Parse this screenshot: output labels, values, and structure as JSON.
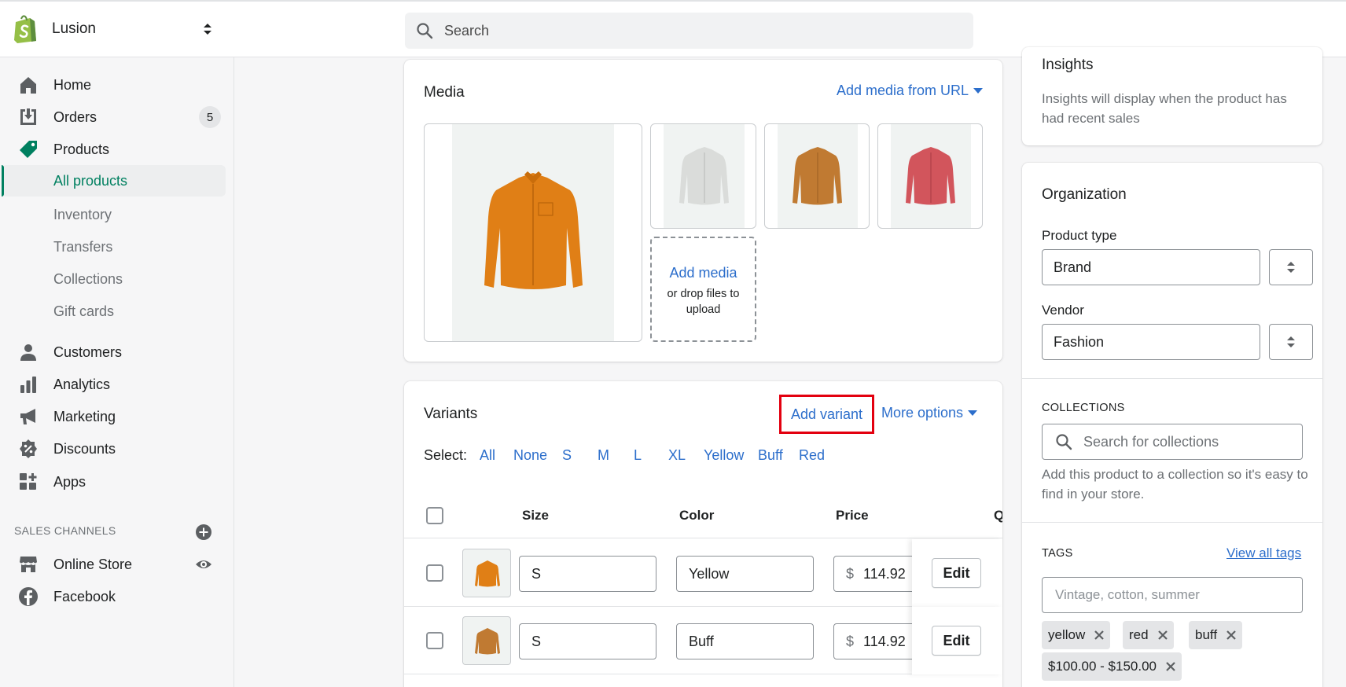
{
  "store": {
    "name": "Lusion"
  },
  "search": {
    "placeholder": "Search"
  },
  "sidebar": {
    "items": [
      {
        "label": "Home",
        "icon": "home-icon"
      },
      {
        "label": "Orders",
        "icon": "orders-icon",
        "badge": "5"
      },
      {
        "label": "Products",
        "icon": "tag-icon"
      },
      {
        "label": "All products"
      },
      {
        "label": "Inventory"
      },
      {
        "label": "Transfers"
      },
      {
        "label": "Collections"
      },
      {
        "label": "Gift cards"
      },
      {
        "label": "Customers",
        "icon": "person-icon"
      },
      {
        "label": "Analytics",
        "icon": "bar-chart-icon"
      },
      {
        "label": "Marketing",
        "icon": "megaphone-icon"
      },
      {
        "label": "Discounts",
        "icon": "discount-icon"
      },
      {
        "label": "Apps",
        "icon": "apps-icon"
      }
    ],
    "sales_channels_title": "SALES CHANNELS",
    "channels": [
      {
        "label": "Online Store",
        "icon": "store-icon"
      },
      {
        "label": "Facebook",
        "icon": "facebook-icon"
      }
    ]
  },
  "media": {
    "title": "Media",
    "add_from_url": "Add media from URL",
    "add_media": "Add media",
    "drop_hint": "or drop files to upload"
  },
  "variants": {
    "title": "Variants",
    "add_variant": "Add variant",
    "more_options": "More options",
    "select_label": "Select:",
    "select_options": [
      "All",
      "None",
      "S",
      "M",
      "L",
      "XL",
      "Yellow",
      "Buff",
      "Red"
    ],
    "columns": [
      "Size",
      "Color",
      "Price",
      "Q"
    ],
    "rows": [
      {
        "size": "S",
        "color": "Yellow",
        "currency": "$",
        "price": "114.92",
        "edit": "Edit"
      },
      {
        "size": "S",
        "color": "Buff",
        "currency": "$",
        "price": "114.92",
        "edit": "Edit"
      }
    ]
  },
  "insights": {
    "title": "Insights",
    "text": "Insights will display when the product has had recent sales"
  },
  "organization": {
    "title": "Organization",
    "product_type_label": "Product type",
    "product_type_value": "Brand",
    "vendor_label": "Vendor",
    "vendor_value": "Fashion",
    "collections_title": "COLLECTIONS",
    "collections_placeholder": "Search for collections",
    "collections_hint": "Add this product to a collection so it's easy to find in your store.",
    "tags_title": "TAGS",
    "view_all_tags": "View all tags",
    "tags_placeholder": "Vintage, cotton, summer",
    "tags": [
      "yellow",
      "red",
      "buff",
      "$100.00 - $150.00"
    ]
  },
  "colors": {
    "accent_green": "#008060",
    "link_blue": "#2c6ecb",
    "highlight_red": "#e3000f",
    "shirt_orange": "#e07f16",
    "shirt_tan": "#c07a32",
    "shirt_red": "#d2555c",
    "shirt_grey": "#dadcda"
  }
}
